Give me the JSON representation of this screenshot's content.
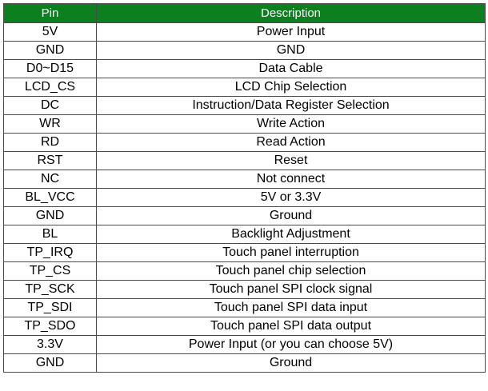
{
  "table": {
    "headers": {
      "pin": "Pin",
      "description": "Description"
    },
    "rows": [
      {
        "pin": "5V",
        "description": "Power Input"
      },
      {
        "pin": "GND",
        "description": "GND"
      },
      {
        "pin": "D0~D15",
        "description": "Data Cable"
      },
      {
        "pin": "LCD_CS",
        "description": "LCD Chip Selection"
      },
      {
        "pin": "DC",
        "description": "Instruction/Data Register Selection"
      },
      {
        "pin": "WR",
        "description": "Write Action"
      },
      {
        "pin": "RD",
        "description": "Read Action"
      },
      {
        "pin": "RST",
        "description": "Reset"
      },
      {
        "pin": "NC",
        "description": "Not connect"
      },
      {
        "pin": "BL_VCC",
        "description": "5V or 3.3V"
      },
      {
        "pin": "GND",
        "description": "Ground"
      },
      {
        "pin": "BL",
        "description": "Backlight Adjustment"
      },
      {
        "pin": "TP_IRQ",
        "description": "Touch panel interruption"
      },
      {
        "pin": "TP_CS",
        "description": "Touch panel chip selection"
      },
      {
        "pin": "TP_SCK",
        "description": "Touch panel SPI clock signal"
      },
      {
        "pin": "TP_SDI",
        "description": "Touch panel SPI data input"
      },
      {
        "pin": "TP_SDO",
        "description": "Touch panel SPI data output"
      },
      {
        "pin": "3.3V",
        "description": "Power Input (or you can choose 5V)"
      },
      {
        "pin": "GND",
        "description": "Ground"
      }
    ]
  },
  "colors": {
    "header_background": "#0c7f1e",
    "header_text": "#ffffff",
    "border": "#4a4a4a"
  }
}
